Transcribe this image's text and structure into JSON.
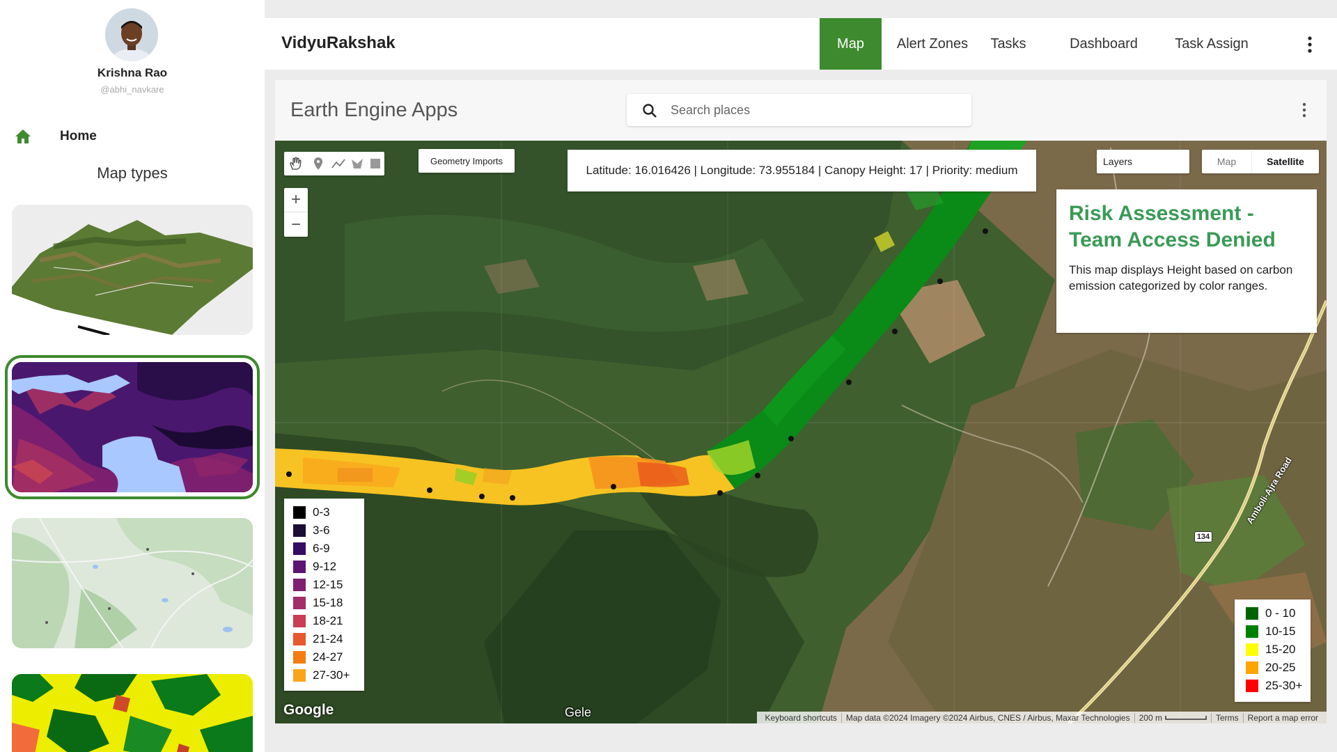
{
  "user": {
    "name": "Krishna Rao",
    "handle": "@abhi_navkare"
  },
  "sidebar": {
    "home_label": "Home",
    "section_title": "Map types"
  },
  "brand": "VidyuRakshak",
  "nav": {
    "items": [
      "Map",
      "Alert Zones",
      "Tasks",
      "Dashboard",
      "Task Assign"
    ],
    "active": "Map"
  },
  "app": {
    "title": "Earth Engine Apps",
    "search_placeholder": "Search places"
  },
  "map": {
    "geometry_imports_label": "Geometry Imports",
    "coord_readout": "Latitude: 16.016426 | Longitude: 73.955184 | Canopy Height: 17 | Priority: medium",
    "layers_label": "Layers",
    "map_type_buttons": [
      "Map",
      "Satellite"
    ],
    "map_type_active": "Satellite",
    "zoom_in": "+",
    "zoom_out": "−",
    "info_title": "Risk Assessment - Team Access Denied",
    "info_text": "This map displays Height based on carbon emission categorized by color ranges.",
    "road_label": "Amboli-Ajra Road",
    "shield_label": "134",
    "place_label": "Gele",
    "google_logo": "Google",
    "scale_label": "200 m",
    "attribution": [
      "Keyboard shortcuts",
      "Map data ©2024 Imagery ©2024 Airbus, CNES / Airbus, Maxar Technologies",
      "200 m",
      "Terms",
      "Report a map error"
    ]
  },
  "legend_left": {
    "entries": [
      {
        "label": "0-3",
        "color": "#000000"
      },
      {
        "label": "3-6",
        "color": "#1b0d35"
      },
      {
        "label": "6-9",
        "color": "#360b62"
      },
      {
        "label": "9-12",
        "color": "#5c1473"
      },
      {
        "label": "12-15",
        "color": "#7e1f71"
      },
      {
        "label": "15-18",
        "color": "#a22f67"
      },
      {
        "label": "18-21",
        "color": "#c93e55"
      },
      {
        "label": "21-24",
        "color": "#e6582e"
      },
      {
        "label": "24-27",
        "color": "#f47c12"
      },
      {
        "label": "27-30+",
        "color": "#f9a51a"
      }
    ]
  },
  "legend_right": {
    "entries": [
      {
        "label": "0 - 10",
        "color": "#006400"
      },
      {
        "label": "10-15",
        "color": "#008000"
      },
      {
        "label": "15-20",
        "color": "#ffff00"
      },
      {
        "label": "20-25",
        "color": "#ffa500"
      },
      {
        "label": "25-30+",
        "color": "#ff0000"
      }
    ]
  },
  "colors": {
    "accent": "#3d8a2f",
    "info_title": "#3a9a56"
  }
}
